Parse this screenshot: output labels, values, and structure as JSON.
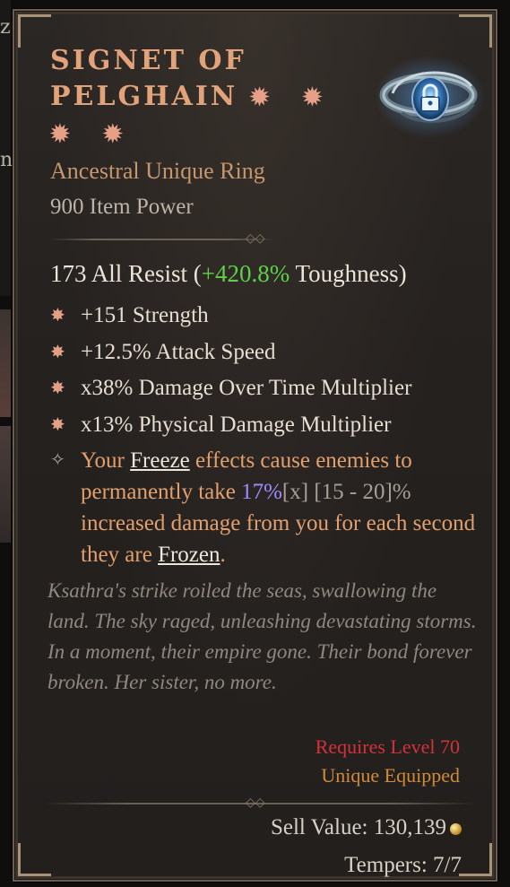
{
  "item": {
    "name": "Signet of Pelghain",
    "stars": "✹ ✹ ✹ ✹",
    "type": "Ancestral Unique Ring",
    "item_power": "900 Item Power",
    "base_stat": {
      "prefix": "173 All Resist (",
      "bonus": "+420.8%",
      "suffix": " Toughness)"
    },
    "affixes": [
      "+151 Strength",
      "+12.5% Attack Speed",
      "x38% Damage Over Time Multiplier",
      "x13% Physical Damage Multiplier"
    ],
    "unique_power": {
      "t1": "Your ",
      "k1": "Freeze",
      "t2": " effects cause enemies to permanently take ",
      "roll": "17%",
      "range": "[x] [15 - 20]%",
      "t3": " increased damage from you for each second they are ",
      "k2": "Frozen",
      "t4": "."
    },
    "flavor_text": "Ksathra's strike roiled the seas, swallowing the land. The sky raged, unleashing devastating storms. In a moment, their empire gone. Their bond forever broken. Her sister, no more.",
    "requirement": "Requires Level 70",
    "equipped_note": "Unique Equipped",
    "sell_value": "Sell Value: 130,139",
    "tempers": "Tempers: 7/7"
  },
  "icons": {
    "affix_bullet": "star-bullet-icon",
    "unique_bullet": "unique-power-icon",
    "item": "ring-icon",
    "gold": "gold-coin-icon"
  },
  "colors": {
    "title": "#e2a27a",
    "unique": "#c6966c",
    "bonus_green": "#5fcf4a",
    "requirement_red": "#d2333a",
    "equipped_orange": "#cf8a3a",
    "roll_purple": "#9d8cff"
  }
}
